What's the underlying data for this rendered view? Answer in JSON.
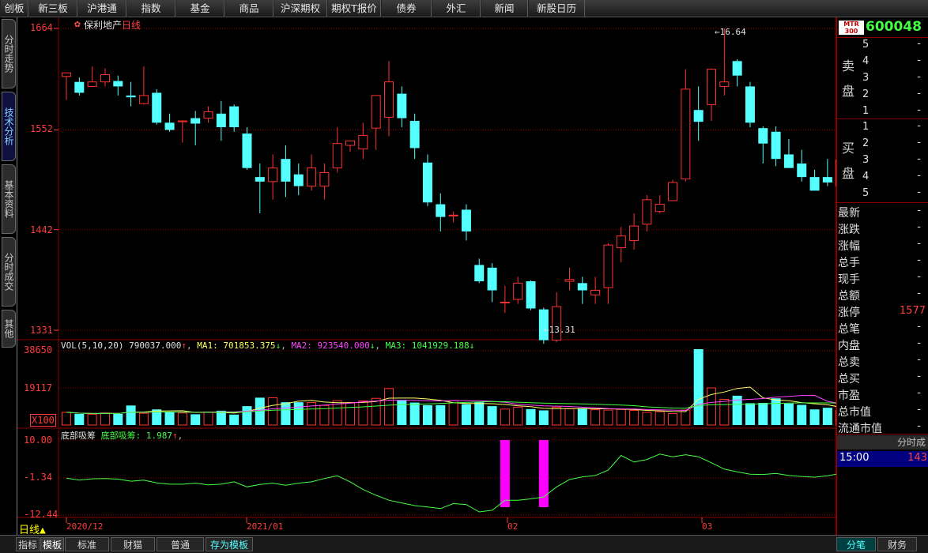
{
  "topbar": {
    "items": [
      "创板",
      "新三板",
      "沪港通",
      "指数",
      "基金",
      "商品",
      "沪深期权",
      "期权T报价",
      "债券",
      "外汇",
      "新闻",
      "新股日历"
    ]
  },
  "lefttabs": [
    "分时走势",
    "技术分析",
    "基本资料",
    "分时成交",
    "其他"
  ],
  "chart": {
    "stock_name": "保利地产",
    "period": "日线",
    "price_axis": [
      "1664",
      "1552",
      "1442",
      "1331"
    ],
    "high_label": "16.64",
    "low_label": "13.31",
    "vol_line": "VOL(5,10,20)",
    "vol_value": "790037.000",
    "ma1": "MA1: 701853.375",
    "ma2": "MA2: 923540.000",
    "ma3": "MA3: 1041929.188",
    "vol_axis": [
      "38650",
      "19117"
    ],
    "vol_unit": "X100",
    "ind_name": "底部吸筹",
    "ind_line": "底部吸筹: 1.987",
    "ind_axis": [
      "10.00",
      "-1.34",
      "-12.44"
    ],
    "period_label": "日线",
    "dates": [
      "2020/12",
      "2021/01",
      "02",
      "03"
    ],
    "colors": {
      "up": "#ff3232",
      "down": "#54ffff",
      "grid": "#8a0000",
      "ma1": "#ffff66",
      "ma2": "#ff44ff",
      "ma3": "#44ff44",
      "signal": "#ff00ff"
    }
  },
  "chart_data": {
    "type": "candlestick",
    "candles": [
      [
        1611,
        1615,
        1585,
        1615
      ],
      [
        1605,
        1610,
        1590,
        1593
      ],
      [
        1600,
        1622,
        1600,
        1605
      ],
      [
        1605,
        1620,
        1600,
        1613
      ],
      [
        1606,
        1612,
        1590,
        1600
      ],
      [
        1590,
        1605,
        1578,
        1588
      ],
      [
        1581,
        1622,
        1580,
        1590
      ],
      [
        1593,
        1597,
        1558,
        1560
      ],
      [
        1560,
        1570,
        1550,
        1552
      ],
      [
        1561,
        1562,
        1538,
        1562
      ],
      [
        1565,
        1573,
        1535,
        1559
      ],
      [
        1565,
        1578,
        1560,
        1572
      ],
      [
        1570,
        1584,
        1540,
        1555
      ],
      [
        1578,
        1580,
        1550,
        1555
      ],
      [
        1548,
        1555,
        1508,
        1510
      ],
      [
        1500,
        1515,
        1460,
        1495
      ],
      [
        1495,
        1525,
        1475,
        1510
      ],
      [
        1520,
        1535,
        1478,
        1495
      ],
      [
        1503,
        1515,
        1480,
        1490
      ],
      [
        1490,
        1525,
        1485,
        1510
      ],
      [
        1490,
        1515,
        1475,
        1505
      ],
      [
        1510,
        1555,
        1505,
        1537
      ],
      [
        1535,
        1540,
        1528,
        1540
      ],
      [
        1531,
        1560,
        1520,
        1546
      ],
      [
        1554,
        1590,
        1530,
        1590
      ],
      [
        1566,
        1628,
        1545,
        1605
      ],
      [
        1592,
        1600,
        1555,
        1565
      ],
      [
        1562,
        1570,
        1520,
        1532
      ],
      [
        1516,
        1525,
        1468,
        1472
      ],
      [
        1470,
        1482,
        1440,
        1456
      ],
      [
        1458,
        1462,
        1450,
        1458
      ],
      [
        1464,
        1470,
        1430,
        1440
      ],
      [
        1403,
        1410,
        1383,
        1385
      ],
      [
        1400,
        1405,
        1362,
        1375
      ],
      [
        1362,
        1380,
        1350,
        1362
      ],
      [
        1365,
        1390,
        1360,
        1383
      ],
      [
        1385,
        1386,
        1353,
        1355
      ],
      [
        1354,
        1356,
        1316,
        1320
      ],
      [
        1320,
        1373,
        1318,
        1357
      ],
      [
        1385,
        1400,
        1375,
        1387
      ],
      [
        1383,
        1390,
        1360,
        1375
      ],
      [
        1370,
        1390,
        1360,
        1375
      ],
      [
        1378,
        1427,
        1360,
        1425
      ],
      [
        1422,
        1445,
        1406,
        1435
      ],
      [
        1430,
        1460,
        1420,
        1446
      ],
      [
        1448,
        1480,
        1440,
        1475
      ],
      [
        1462,
        1480,
        1460,
        1470
      ],
      [
        1474,
        1497,
        1474,
        1494
      ],
      [
        1498,
        1619,
        1495,
        1597
      ],
      [
        1574,
        1600,
        1540,
        1561
      ],
      [
        1580,
        1620,
        1562,
        1619
      ],
      [
        1600,
        1664,
        1590,
        1605
      ],
      [
        1628,
        1630,
        1600,
        1612
      ],
      [
        1600,
        1605,
        1555,
        1560
      ],
      [
        1554,
        1556,
        1515,
        1537
      ],
      [
        1550,
        1556,
        1512,
        1520
      ],
      [
        1525,
        1542,
        1510,
        1510
      ],
      [
        1515,
        1530,
        1495,
        1500
      ],
      [
        1500,
        1508,
        1485,
        1485
      ],
      [
        1500,
        1520,
        1490,
        1494
      ],
      [
        1490,
        1535,
        1470,
        1519
      ]
    ],
    "volume": [
      195,
      170,
      165,
      185,
      170,
      300,
      180,
      240,
      195,
      185,
      165,
      200,
      220,
      160,
      290,
      420,
      420,
      350,
      350,
      345,
      300,
      375,
      345,
      370,
      410,
      560,
      385,
      345,
      305,
      305,
      375,
      320,
      350,
      290,
      245,
      275,
      245,
      225,
      275,
      250,
      260,
      235,
      230,
      240,
      225,
      195,
      205,
      175,
      230,
      1165,
      570,
      395,
      450,
      335,
      340,
      410,
      330,
      310,
      240,
      265,
      225
    ],
    "indicator": [
      -1.4,
      -2.0,
      -1.6,
      -1.5,
      -1.7,
      -2.3,
      -2.0,
      -2.8,
      -3.2,
      -3.2,
      -2.9,
      -3.4,
      -3.2,
      -2.5,
      -4.0,
      -3.3,
      -2.9,
      -3.5,
      -2.9,
      -2.5,
      -1.5,
      -0.7,
      -2.5,
      -4.8,
      -6.5,
      -8.0,
      -8.8,
      -9.6,
      -10.0,
      -10.5,
      -9.0,
      -9.3,
      -11.5,
      -11.0,
      -8.0,
      -8.0,
      -7.6,
      -7.0,
      -4.0,
      -1.8,
      -1.0,
      -0.6,
      1.0,
      5.4,
      3.4,
      4.2,
      5.8,
      5.0,
      5.6,
      5.0,
      3.2,
      1.3,
      0.5,
      -0.2,
      -0.3,
      0.0,
      -0.6,
      -0.9,
      -1.1,
      -0.7,
      0.0
    ],
    "ind_signals": [
      34,
      37
    ],
    "price_range": [
      1310,
      1680
    ]
  },
  "rightpanel": {
    "code": "600048",
    "logo": "MTR 300",
    "sell_label": "卖盘",
    "buy_label": "买盘",
    "sell_levels": [
      "5",
      "4",
      "3",
      "2",
      "1"
    ],
    "buy_levels": [
      "1",
      "2",
      "3",
      "4",
      "5"
    ],
    "dash": "-",
    "fields": [
      "最新",
      "涨跌",
      "涨幅",
      "总手",
      "现手",
      "总额",
      "涨停",
      "总笔",
      "内盘",
      "总卖",
      "总买",
      "市盈",
      "总市值",
      "流通市值"
    ],
    "limit_up": "1577",
    "fenshi_label": "分时成",
    "time": "15:00",
    "time_val": "143",
    "tabs": [
      "分笔",
      "财务"
    ]
  },
  "bottombar": {
    "tabs": [
      "指标",
      "模板",
      "标准",
      "财猫",
      "普通",
      "存为模板"
    ]
  }
}
